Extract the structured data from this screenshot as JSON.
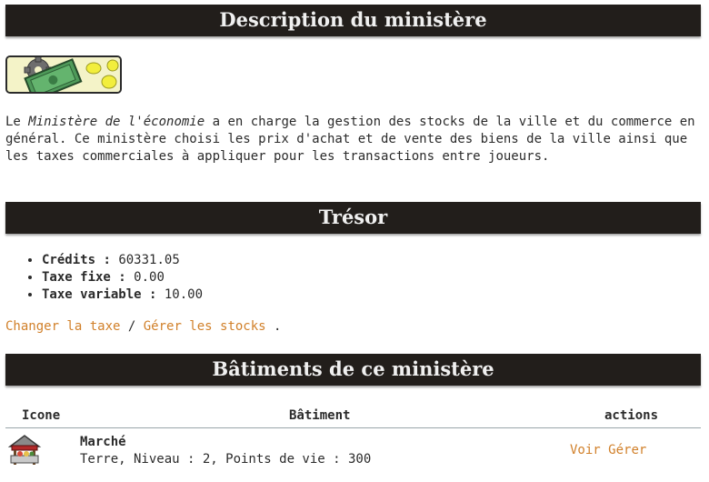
{
  "headers": {
    "description": "Description du ministère",
    "tresor": "Trésor",
    "batiments": "Bâtiments de ce ministère"
  },
  "icons": {
    "ministry": "gear-and-banknote-icon",
    "building": "market-stall-icon"
  },
  "description": {
    "prefix": "Le ",
    "ministry_name": "Ministère de l'économie",
    "rest": " a en charge la gestion des stocks de la ville et du commerce en général. Ce ministère choisi les prix d'achat et de vente des biens de la ville ainsi que les taxes commerciales à appliquer pour les transactions entre joueurs."
  },
  "tresor": {
    "items": [
      {
        "label": "Crédits",
        "sep": " : ",
        "value": "60331.05"
      },
      {
        "label": "Taxe fixe",
        "sep": " : ",
        "value": "0.00"
      },
      {
        "label": "Taxe variable",
        "sep": " : ",
        "value": "10.00"
      }
    ],
    "links": {
      "change_tax": "Changer la taxe",
      "separator": " / ",
      "manage_stocks": "Gérer les stocks",
      "end": " ."
    }
  },
  "table": {
    "columns": [
      "Icone",
      "Bâtiment",
      "actions"
    ],
    "rows": [
      {
        "name": "Marché",
        "info": "Terre, Niveau : 2, Points de vie : 300",
        "action_view": "Voir",
        "action_manage": "Gérer"
      }
    ]
  },
  "colors": {
    "header_bg": "#221e1b",
    "header_text": "#f0f0f0",
    "link": "#d1802a",
    "text": "#2b2b2b"
  }
}
